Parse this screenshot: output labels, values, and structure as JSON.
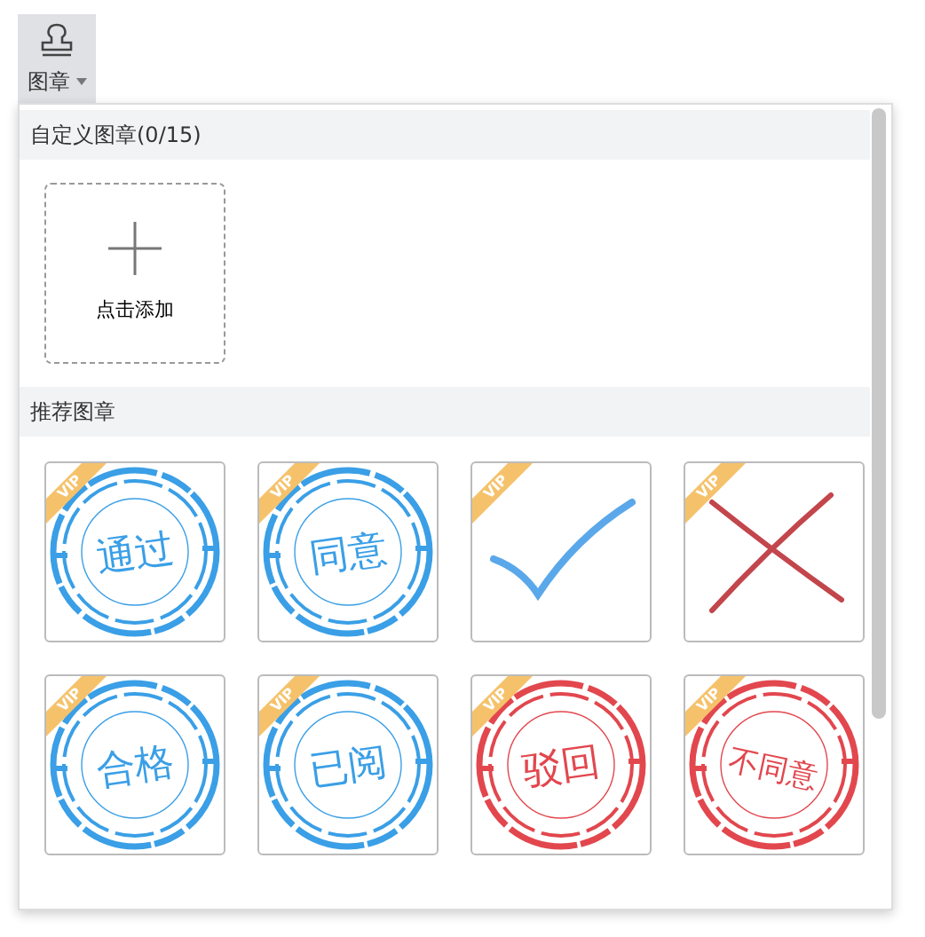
{
  "toolbar_button": {
    "label": "图章",
    "expanded": true
  },
  "custom_section": {
    "title": "自定义图章(0/15)",
    "add_label": "点击添加"
  },
  "recommended_section": {
    "title": "推荐图章",
    "stamps": [
      {
        "kind": "seal",
        "text": "通过",
        "color": "#3a9fe6",
        "badge": "VIP"
      },
      {
        "kind": "seal",
        "text": "同意",
        "color": "#3a9fe6",
        "badge": "VIP"
      },
      {
        "kind": "check",
        "color": "#5aa8ea",
        "badge": "VIP"
      },
      {
        "kind": "cross",
        "color": "#c2464c",
        "badge": "VIP"
      },
      {
        "kind": "seal",
        "text": "合格",
        "color": "#3a9fe6",
        "badge": "VIP"
      },
      {
        "kind": "seal",
        "text": "已阅",
        "color": "#3a9fe6",
        "badge": "VIP"
      },
      {
        "kind": "seal",
        "text": "驳回",
        "color": "#e2474e",
        "badge": "VIP"
      },
      {
        "kind": "seal",
        "text": "不同意",
        "color": "#e2474e",
        "badge": "VIP"
      }
    ]
  }
}
